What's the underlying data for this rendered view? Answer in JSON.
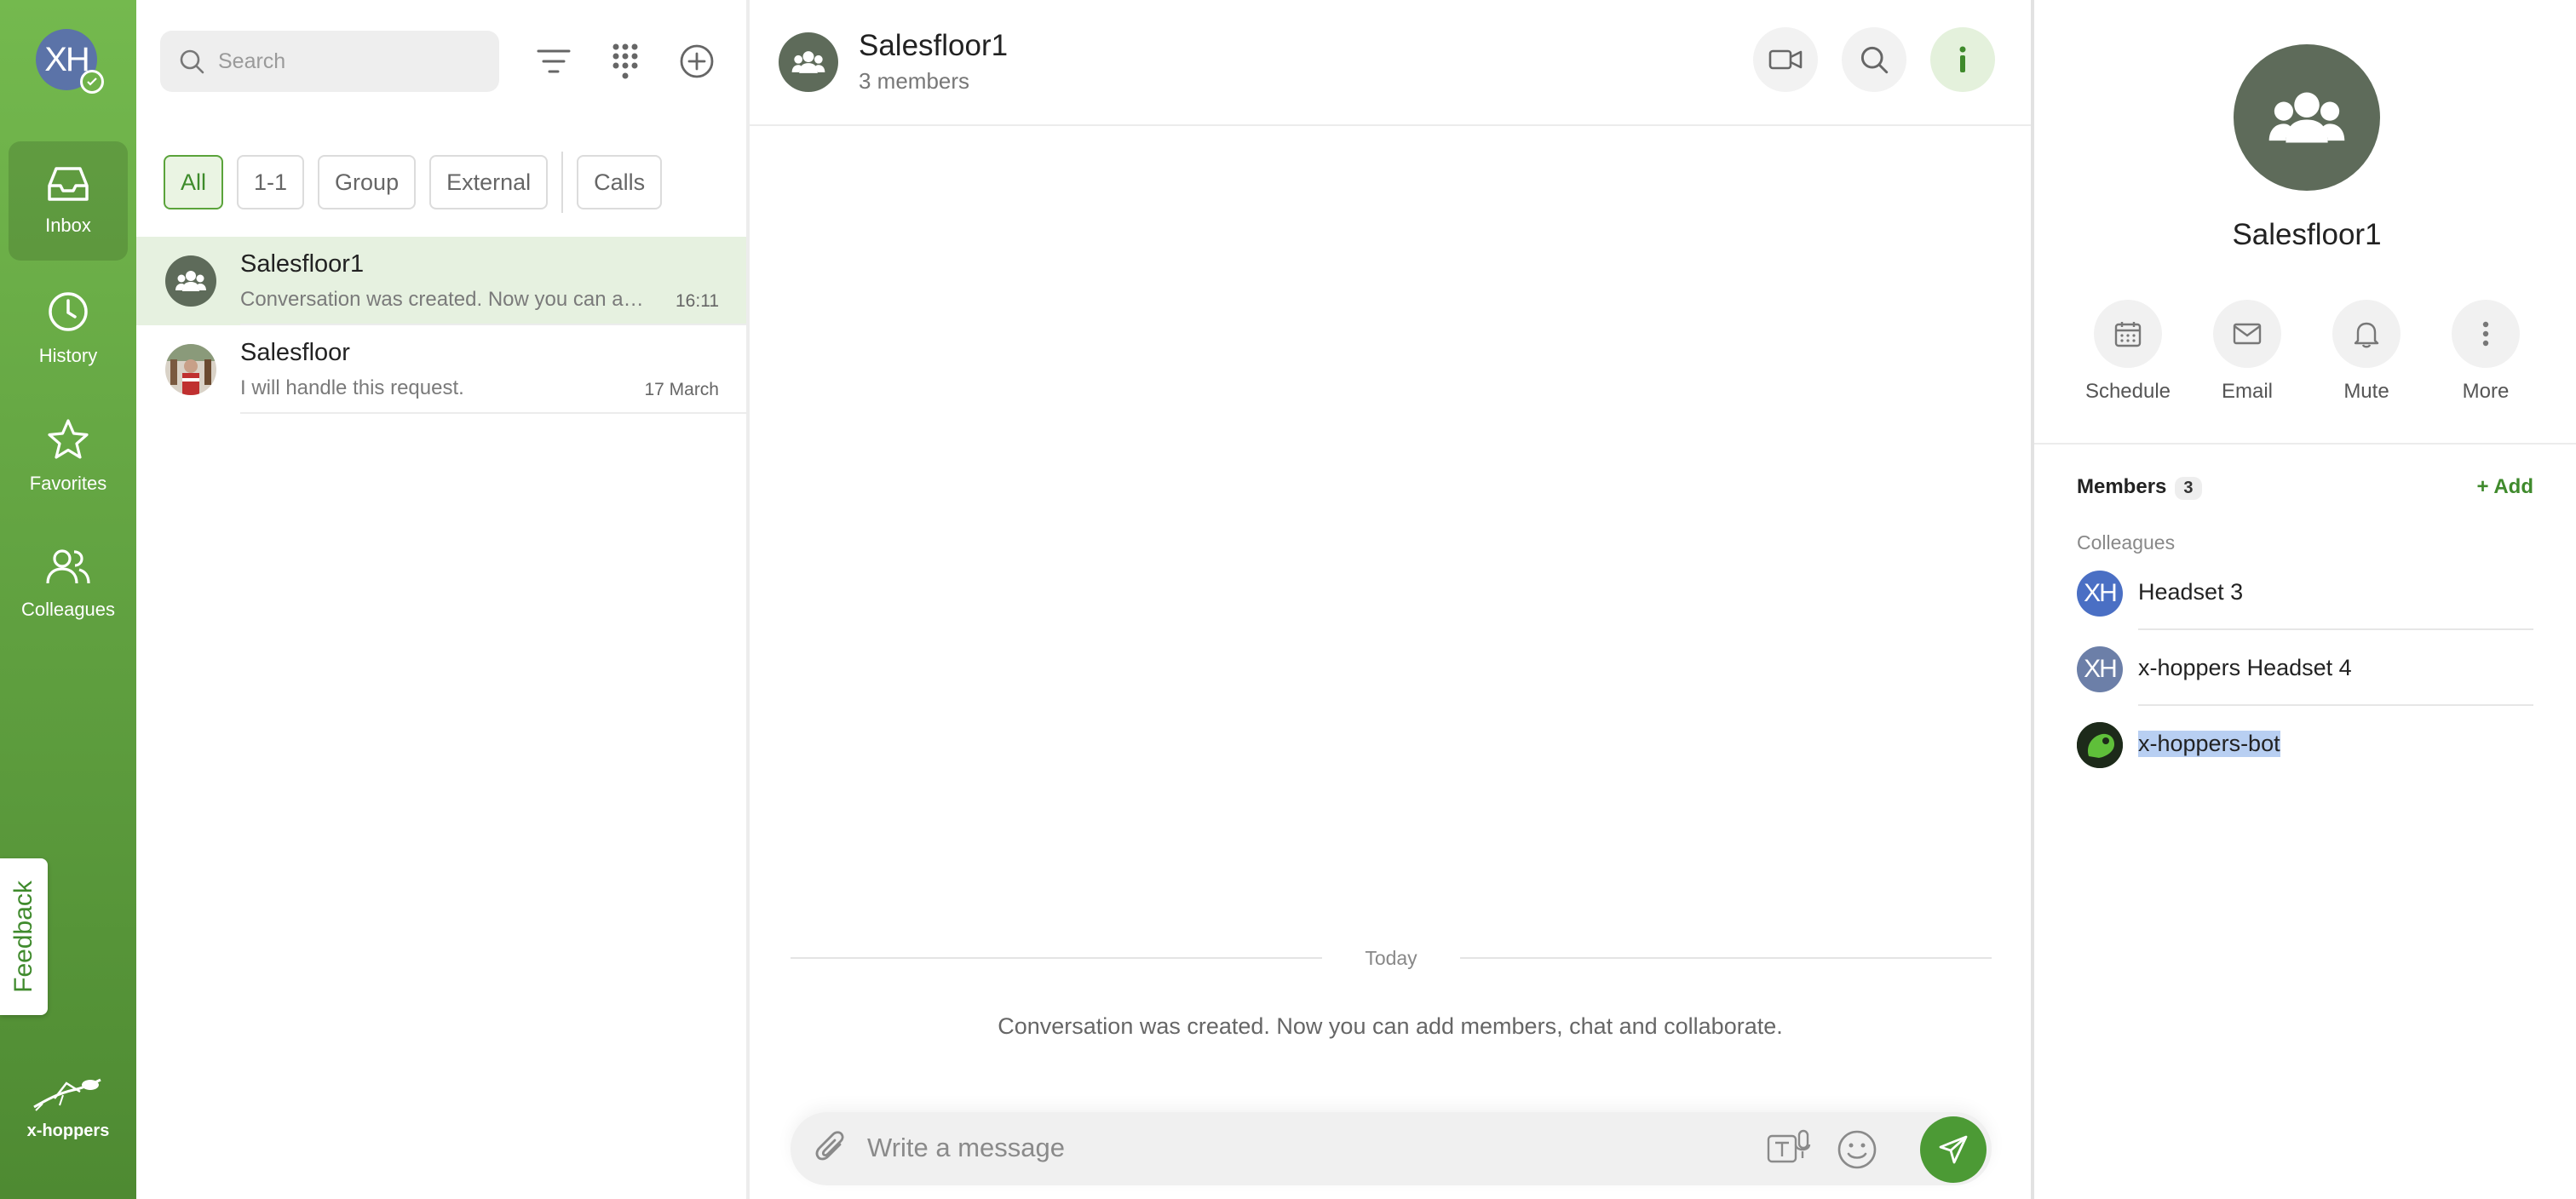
{
  "user": {
    "initials": "XH"
  },
  "nav": {
    "items": [
      {
        "label": "Inbox"
      },
      {
        "label": "History"
      },
      {
        "label": "Favorites"
      },
      {
        "label": "Colleagues"
      }
    ],
    "feedback_label": "Feedback",
    "brand": "x-hoppers"
  },
  "search": {
    "placeholder": "Search"
  },
  "filters": [
    "All",
    "1-1",
    "Group",
    "External",
    "Calls"
  ],
  "conversations": [
    {
      "title": "Salesfloor1",
      "preview": "Conversation was created. Now you can add members, chat and collaborate.",
      "time": "16:11"
    },
    {
      "title": "Salesfloor",
      "preview": "I will handle this request.",
      "time": "17 March"
    }
  ],
  "chat": {
    "title": "Salesfloor1",
    "subtitle": "3 members",
    "date_separator": "Today",
    "system_message": "Conversation was created. Now you can add members, chat and collaborate.",
    "composer_placeholder": "Write a message"
  },
  "details": {
    "title": "Salesfloor1",
    "actions": [
      "Schedule",
      "Email",
      "Mute",
      "More"
    ],
    "members_label": "Members",
    "members_count": "3",
    "add_label": "+ Add",
    "group_label": "Colleagues",
    "members": [
      {
        "initials": "XH",
        "name": "Headset 3",
        "color": "#4a6fc4"
      },
      {
        "initials": "XH",
        "name": "x-hoppers Headset 4",
        "color": "#6c7fa8"
      },
      {
        "initials": "",
        "name": "x-hoppers-bot",
        "color": "#1f3a1a"
      }
    ]
  },
  "colors": {
    "accent": "#4c9a35",
    "nav_green": "#6aae45",
    "selected_row": "#e6f1e0"
  }
}
